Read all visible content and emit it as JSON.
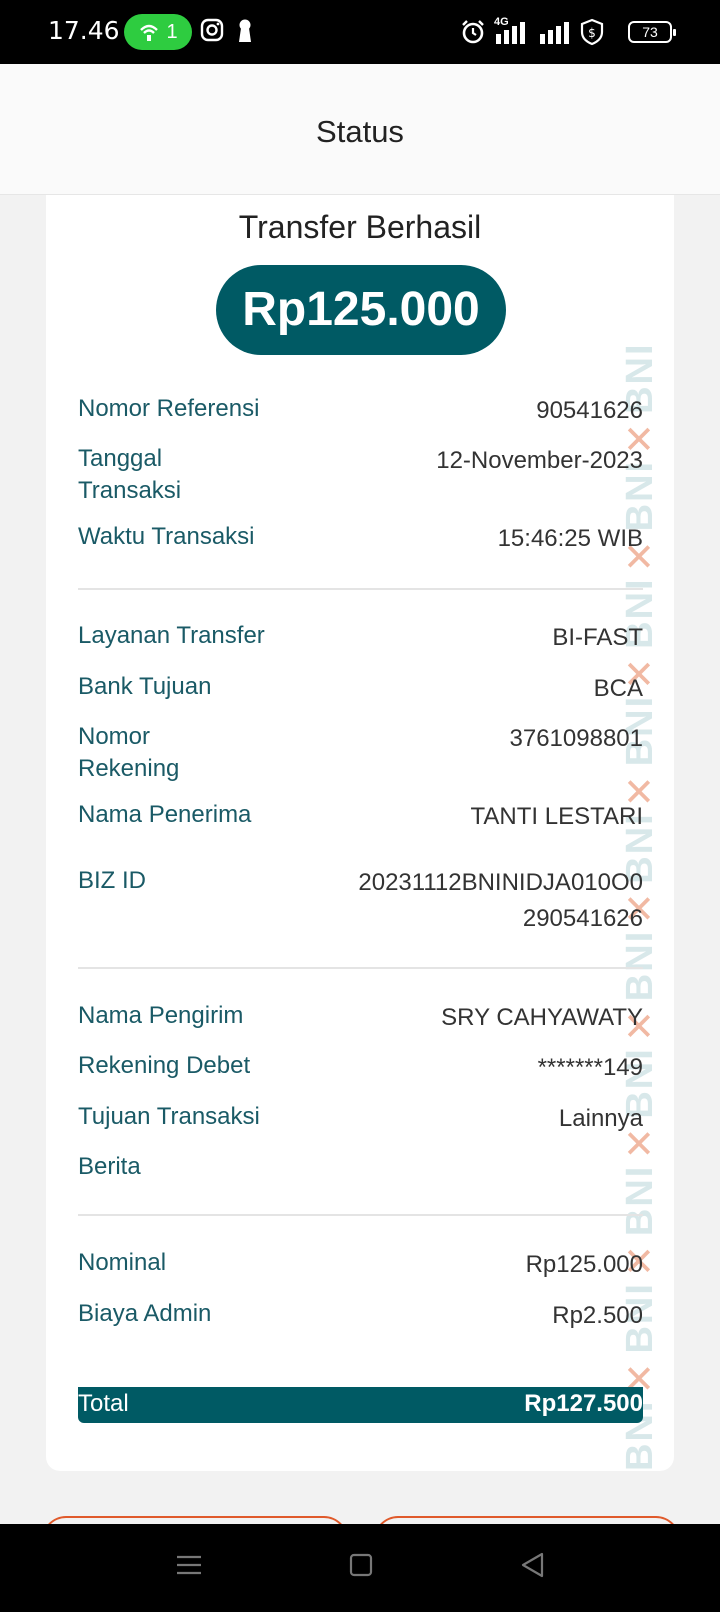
{
  "status_bar": {
    "time": "17.46",
    "pill_count": "1",
    "battery": "73",
    "network": "4G"
  },
  "header": {
    "title": "Status"
  },
  "receipt": {
    "title": "Transfer Berhasil",
    "amount": "Rp125.000",
    "watermark": "BNI",
    "section1": [
      {
        "label": "Nomor Referensi",
        "value": "90541626"
      },
      {
        "label": "Tanggal Transaksi",
        "value": "12-November-2023"
      },
      {
        "label": "Waktu Transaksi",
        "value": "15:46:25 WIB"
      }
    ],
    "section2": [
      {
        "label": "Layanan Transfer",
        "value": "BI-FAST"
      },
      {
        "label": "Bank Tujuan",
        "value": "BCA"
      },
      {
        "label": "Nomor Rekening",
        "value": "3761098801"
      },
      {
        "label": "Nama Penerima",
        "value": "TANTI LESTARI"
      },
      {
        "label": "BIZ ID",
        "value_line1": "20231112BNINIDJA010O0",
        "value_line2": "290541626"
      }
    ],
    "section3": [
      {
        "label": "Nama Pengirim",
        "value": "SRY CAHYAWATY"
      },
      {
        "label": "Rekening Debet",
        "value": "*******149"
      },
      {
        "label": "Tujuan Transaksi",
        "value": "Lainnya"
      },
      {
        "label": "Berita",
        "value": ""
      }
    ],
    "section4": [
      {
        "label": "Nominal",
        "value": "Rp125.000"
      },
      {
        "label": "Biaya Admin",
        "value": "Rp2.500"
      }
    ],
    "total": {
      "label": "Total",
      "value": "Rp127.500"
    }
  },
  "colors": {
    "accent": "#005a64",
    "label": "#1a5a66",
    "button_outline": "#e05a2b"
  }
}
